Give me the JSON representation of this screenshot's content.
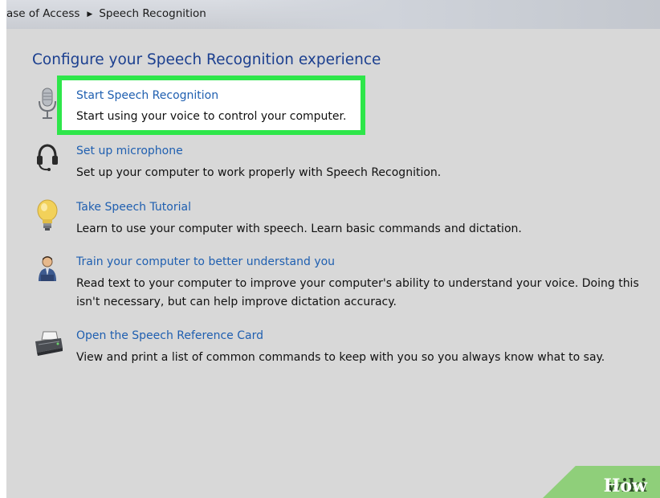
{
  "breadcrumb": {
    "parent": "ase of Access",
    "current": "Speech Recognition"
  },
  "page_title": "Configure your Speech Recognition experience",
  "items": [
    {
      "link": "Start Speech Recognition",
      "desc": "Start using your voice to control your computer.",
      "icon": "microphone-icon"
    },
    {
      "link": "Set up microphone",
      "desc": "Set up your computer to work properly with Speech Recognition.",
      "icon": "headset-icon"
    },
    {
      "link": "Take Speech Tutorial",
      "desc": "Learn to use your computer with speech.  Learn basic commands and dictation.",
      "icon": "lightbulb-icon"
    },
    {
      "link": "Train your computer to better understand you",
      "desc": "Read text to your computer to improve your computer's ability to understand your voice.  Doing this isn't necessary, but can help improve dictation accuracy.",
      "icon": "user-icon"
    },
    {
      "link": "Open the Speech Reference Card",
      "desc": "View and print a list of common commands to keep with you so you always know what to say.",
      "icon": "printer-icon"
    }
  ],
  "colors": {
    "link": "#1f5fb0",
    "title": "#1b3f8f",
    "highlight_border": "#2ee64a"
  },
  "watermark": {
    "wiki": "wiki",
    "how": "How"
  }
}
